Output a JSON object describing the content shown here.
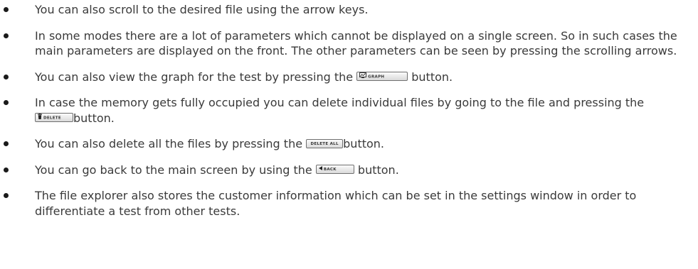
{
  "bullets": [
    {
      "text": "You can also scroll to the desired file using the arrow keys."
    },
    {
      "text": "In some modes there are a lot of parameters which cannot be displayed on a single screen. So in such cases the main parameters are displayed on the front. The other parameters can be seen by pressing the scrolling arrows."
    },
    {
      "before": "You can also view the graph for the test by pressing the ",
      "after": " button."
    },
    {
      "before": "In case the memory gets fully occupied you can delete individual files by going to the file and pressing the ",
      "after": "button."
    },
    {
      "before": "You can also delete all the files by pressing the ",
      "after": "button."
    },
    {
      "before": "You can go back to the main screen by using the ",
      "after": " button."
    },
    {
      "text": "The file explorer also stores the customer information which can be set in the settings window in order to differentiate a test from other tests."
    }
  ],
  "buttons": {
    "graph": {
      "label": "GRAPH",
      "icon": "graph-icon"
    },
    "delete": {
      "label": "DELETE",
      "icon": "trash-icon"
    },
    "delete_all": {
      "label": "DELETE ALL"
    },
    "back": {
      "label": "BACK",
      "icon": "back-arrow-icon"
    }
  }
}
